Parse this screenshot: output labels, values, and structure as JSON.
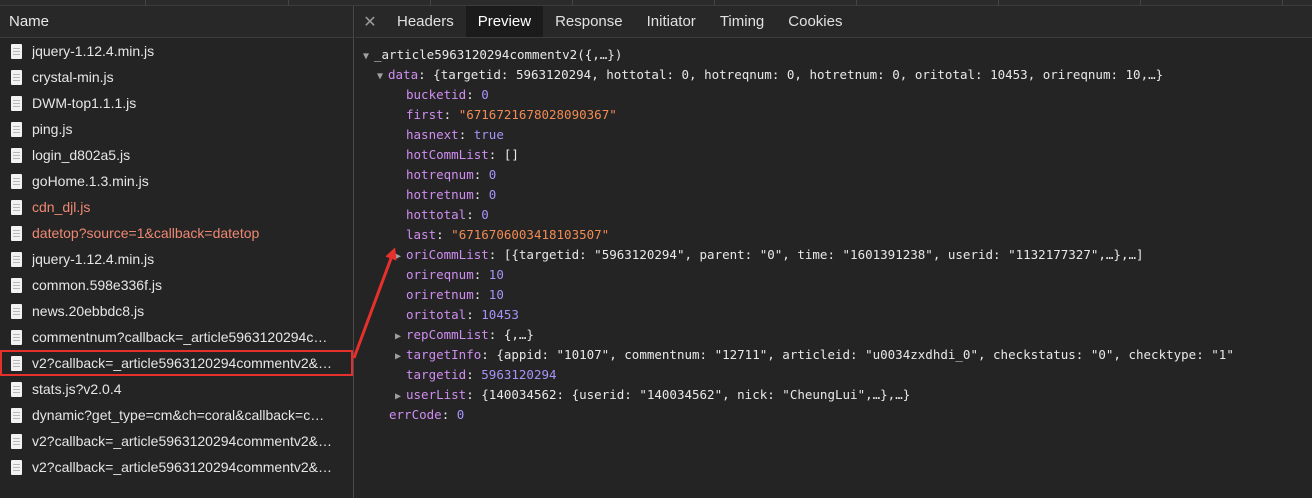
{
  "network": {
    "name_header": "Name",
    "requests": [
      {
        "label": "jquery-1.12.4.min.js",
        "error": false
      },
      {
        "label": "crystal-min.js",
        "error": false
      },
      {
        "label": "DWM-top1.1.1.js",
        "error": false
      },
      {
        "label": "ping.js",
        "error": false
      },
      {
        "label": "login_d802a5.js",
        "error": false
      },
      {
        "label": "goHome.1.3.min.js",
        "error": false
      },
      {
        "label": "cdn_djl.js",
        "error": true
      },
      {
        "label": "datetop?source=1&callback=datetop",
        "error": true
      },
      {
        "label": "jquery-1.12.4.min.js",
        "error": false
      },
      {
        "label": "common.598e336f.js",
        "error": false
      },
      {
        "label": "news.20ebbdc8.js",
        "error": false
      },
      {
        "label": "commentnum?callback=_article5963120294c…",
        "error": false
      },
      {
        "label": "v2?callback=_article5963120294commentv2&…",
        "error": false,
        "selected": true
      },
      {
        "label": "stats.js?v2.0.4",
        "error": false
      },
      {
        "label": "dynamic?get_type=cm&ch=coral&callback=c…",
        "error": false
      },
      {
        "label": "v2?callback=_article5963120294commentv2&…",
        "error": false
      },
      {
        "label": "v2?callback=_article5963120294commentv2&…",
        "error": false
      }
    ]
  },
  "detail": {
    "close_icon": "close-icon",
    "tabs": [
      "Headers",
      "Preview",
      "Response",
      "Initiator",
      "Timing",
      "Cookies"
    ],
    "active_tab": "Preview"
  },
  "preview": {
    "root": "_article5963120294commentv2({,…})",
    "data_key": "data",
    "data_summary": "{targetid: 5963120294, hottotal: 0, hotreqnum: 0, hotretnum: 0, oritotal: 10453, orireqnum: 10,…}",
    "fields": [
      {
        "key": "bucketid",
        "value": "0",
        "type": "num"
      },
      {
        "key": "first",
        "value": "\"6716721678028090367\"",
        "type": "str"
      },
      {
        "key": "hasnext",
        "value": "true",
        "type": "bool"
      },
      {
        "key": "hotCommList",
        "value": "[]",
        "type": "txt"
      },
      {
        "key": "hotreqnum",
        "value": "0",
        "type": "num"
      },
      {
        "key": "hotretnum",
        "value": "0",
        "type": "num"
      },
      {
        "key": "hottotal",
        "value": "0",
        "type": "num"
      },
      {
        "key": "last",
        "value": "\"6716706003418103507\"",
        "type": "str"
      },
      {
        "key": "oriCommList",
        "value": "[{targetid: \"5963120294\", parent: \"0\", time: \"1601391238\", userid: \"1132177327\",…},…]",
        "type": "txt",
        "expandable": true
      },
      {
        "key": "orireqnum",
        "value": "10",
        "type": "num"
      },
      {
        "key": "oriretnum",
        "value": "10",
        "type": "num"
      },
      {
        "key": "oritotal",
        "value": "10453",
        "type": "num"
      },
      {
        "key": "repCommList",
        "value": "{,…}",
        "type": "txt",
        "expandable": true
      },
      {
        "key": "targetInfo",
        "value": "{appid: \"10107\", commentnum: \"12711\", articleid: \"u0034zxdhdi_0\", checkstatus: \"0\", checktype: \"1\"",
        "type": "txt",
        "expandable": true
      },
      {
        "key": "targetid",
        "value": "5963120294",
        "type": "num"
      },
      {
        "key": "userList",
        "value": "{140034562: {userid: \"140034562\", nick: \"CheungLui\",…},…}",
        "type": "txt",
        "expandable": true
      }
    ],
    "errcode_key": "errCode",
    "errcode_value": "0"
  },
  "colors": {
    "selection_box": "#e6302b",
    "annotation_arrow": "#e6302b",
    "error_request": "#ee8873",
    "string_value": "#f28b54",
    "number_value": "#a893f7",
    "key": "#cf8ef0"
  }
}
